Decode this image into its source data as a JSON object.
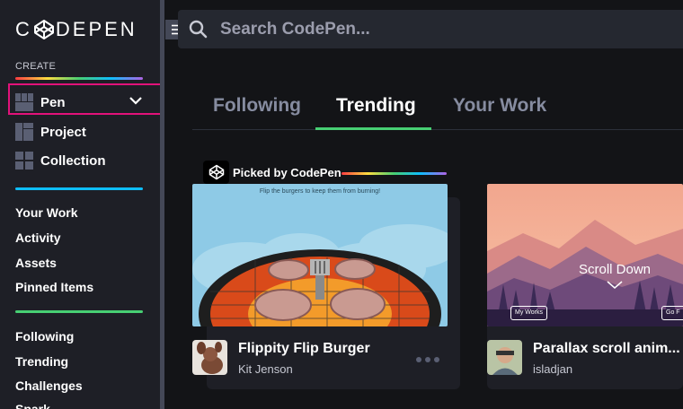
{
  "logo": {
    "text_before": "C",
    "text_after": "DEPEN"
  },
  "sidebar": {
    "create_label": "CREATE",
    "create_items": [
      {
        "label": "Pen",
        "icon": "pen-grid-icon"
      },
      {
        "label": "Project",
        "icon": "project-icon"
      },
      {
        "label": "Collection",
        "icon": "collection-icon"
      }
    ],
    "nav_group_1": [
      "Your Work",
      "Activity",
      "Assets",
      "Pinned Items"
    ],
    "nav_group_2": [
      "Following",
      "Trending",
      "Challenges",
      "Spark"
    ]
  },
  "search": {
    "placeholder": "Search CodePen..."
  },
  "tabs": [
    {
      "label": "Following",
      "active": false
    },
    {
      "label": "Trending",
      "active": true
    },
    {
      "label": "Your Work",
      "active": false
    }
  ],
  "cards": [
    {
      "badge": "Picked by CodePen",
      "preview_caption": "Flip the burgers to keep them from burning!",
      "title": "Flippity Flip Burger",
      "author": "Kit Jenson"
    },
    {
      "preview_text": "Scroll Down",
      "preview_btn_left": "My Works",
      "preview_btn_right": "Go F",
      "title": "Parallax scroll anim...",
      "author": "isladjan"
    }
  ],
  "colors": {
    "accent_pink": "#e2127a",
    "accent_green": "#47cf73",
    "accent_blue": "#0ebeff"
  }
}
